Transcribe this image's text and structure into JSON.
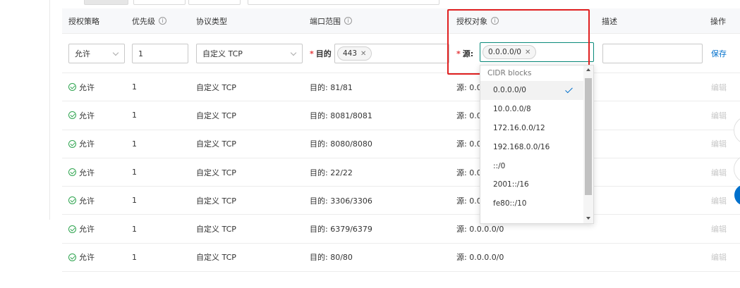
{
  "header": {
    "policy": "授权策略",
    "priority": "优先级",
    "protocol": "协议类型",
    "port": "端口范围",
    "target": "授权对象",
    "desc": "描述",
    "action": "操作"
  },
  "edit_row": {
    "policy_value": "允许",
    "priority_value": "1",
    "protocol_value": "自定义 TCP",
    "dest_label": "目的",
    "dest_tag": "443",
    "source_label": "源:",
    "source_tag": "0.0.0.0/0",
    "desc_value": "",
    "save_label": "保存"
  },
  "rows": [
    {
      "policy": "允许",
      "priority": "1",
      "protocol": "自定义 TCP",
      "port": "目的: 81/81",
      "source": "源: 0.0",
      "action": "编辑"
    },
    {
      "policy": "允许",
      "priority": "1",
      "protocol": "自定义 TCP",
      "port": "目的: 8081/8081",
      "source": "源: 0.0",
      "action": "编辑"
    },
    {
      "policy": "允许",
      "priority": "1",
      "protocol": "自定义 TCP",
      "port": "目的: 8080/8080",
      "source": "源: 0.0",
      "action": "编辑"
    },
    {
      "policy": "允许",
      "priority": "1",
      "protocol": "自定义 TCP",
      "port": "目的: 22/22",
      "source": "源: 0.0",
      "action": "编辑"
    },
    {
      "policy": "允许",
      "priority": "1",
      "protocol": "自定义 TCP",
      "port": "目的: 3306/3306",
      "source": "源: 0.0",
      "action": "编辑"
    },
    {
      "policy": "允许",
      "priority": "1",
      "protocol": "自定义 TCP",
      "port": "目的: 6379/6379",
      "source": "源: 0.0.0.0/0",
      "action": "编辑"
    },
    {
      "policy": "允许",
      "priority": "1",
      "protocol": "自定义 TCP",
      "port": "目的: 80/80",
      "source": "源: 0.0.0.0/0",
      "action": "编辑"
    }
  ],
  "dropdown": {
    "group_label": "CIDR blocks",
    "selected": "0.0.0.0/0",
    "options": [
      "0.0.0.0/0",
      "10.0.0.0/8",
      "172.16.0.0/12",
      "192.168.0.0/16",
      "::/0",
      "2001::/16",
      "fe80::/10"
    ]
  },
  "colors": {
    "accent": "#0070cc",
    "highlight": "#e02020",
    "allow": "#2ea44f"
  }
}
